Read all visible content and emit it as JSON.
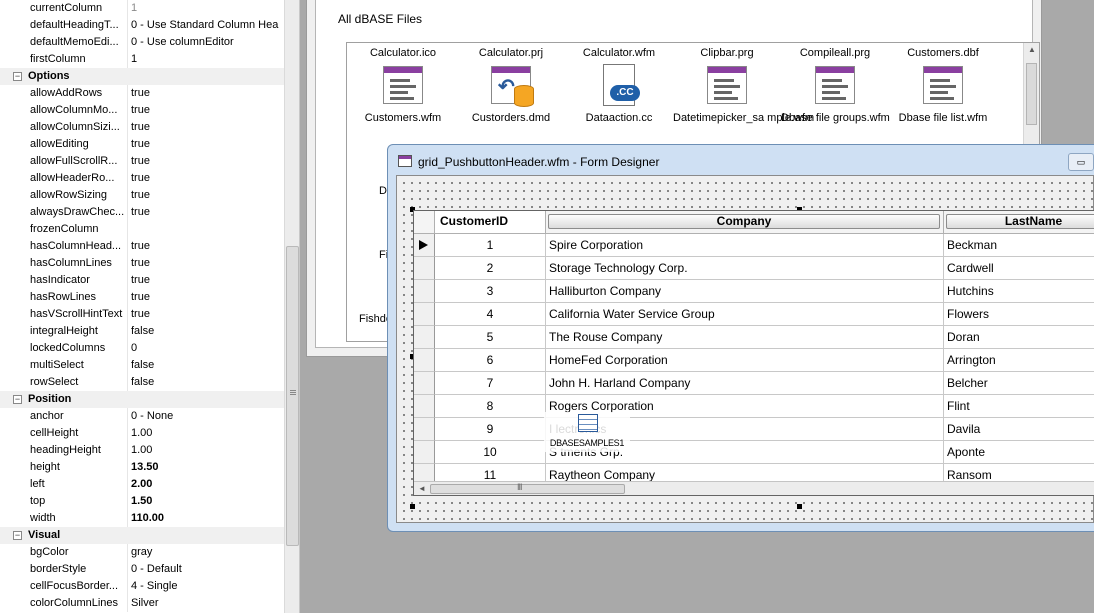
{
  "inspector": {
    "top_rows": [
      {
        "name": "currentColumn",
        "value": "1",
        "style": "muted"
      },
      {
        "name": "defaultHeadingT...",
        "value": "0 - Use Standard Column Hea",
        "style": ""
      },
      {
        "name": "defaultMemoEdi...",
        "value": "0 - Use columnEditor",
        "style": ""
      },
      {
        "name": "firstColumn",
        "value": "1",
        "style": ""
      }
    ],
    "options_label": "Options",
    "options_rows": [
      {
        "name": "allowAddRows",
        "value": "true",
        "style": ""
      },
      {
        "name": "allowColumnMo...",
        "value": "true",
        "style": ""
      },
      {
        "name": "allowColumnSizi...",
        "value": "true",
        "style": ""
      },
      {
        "name": "allowEditing",
        "value": "true",
        "style": ""
      },
      {
        "name": "allowFullScrollR...",
        "value": "true",
        "style": ""
      },
      {
        "name": "allowHeaderRo...",
        "value": "true",
        "style": ""
      },
      {
        "name": "allowRowSizing",
        "value": "true",
        "style": ""
      },
      {
        "name": "alwaysDrawChec...",
        "value": "true",
        "style": ""
      },
      {
        "name": "frozenColumn",
        "value": "",
        "style": ""
      },
      {
        "name": "hasColumnHead...",
        "value": "true",
        "style": ""
      },
      {
        "name": "hasColumnLines",
        "value": "true",
        "style": ""
      },
      {
        "name": "hasIndicator",
        "value": "true",
        "style": ""
      },
      {
        "name": "hasRowLines",
        "value": "true",
        "style": ""
      },
      {
        "name": "hasVScrollHintText",
        "value": "true",
        "style": ""
      },
      {
        "name": "integralHeight",
        "value": "false",
        "style": ""
      },
      {
        "name": "lockedColumns",
        "value": "0",
        "style": ""
      },
      {
        "name": "multiSelect",
        "value": "false",
        "style": ""
      },
      {
        "name": "rowSelect",
        "value": "false",
        "style": ""
      }
    ],
    "position_label": "Position",
    "position_rows": [
      {
        "name": "anchor",
        "value": "0 - None",
        "style": ""
      },
      {
        "name": "cellHeight",
        "value": "1.00",
        "style": ""
      },
      {
        "name": "headingHeight",
        "value": "1.00",
        "style": ""
      },
      {
        "name": "height",
        "value": "13.50",
        "style": "bold"
      },
      {
        "name": "left",
        "value": "2.00",
        "style": "bold"
      },
      {
        "name": "top",
        "value": "1.50",
        "style": "bold"
      },
      {
        "name": "width",
        "value": "110.00",
        "style": "bold"
      }
    ],
    "visual_label": "Visual",
    "visual_rows": [
      {
        "name": "bgColor",
        "value": "gray",
        "style": ""
      },
      {
        "name": "borderStyle",
        "value": "0 - Default",
        "style": ""
      },
      {
        "name": "cellFocusBorder...",
        "value": "4 - Single",
        "style": ""
      },
      {
        "name": "colorColumnLines",
        "value": "Silver",
        "style": ""
      }
    ]
  },
  "navigator": {
    "caption": "All dBASE Files",
    "files": [
      {
        "top": "Calculator.ico",
        "bottom": "Customers.wfm",
        "icon": "form-icon"
      },
      {
        "top": "Calculator.prj",
        "bottom": "Custorders.dmd",
        "icon": "datamodule-icon"
      },
      {
        "top": "Calculator.wfm",
        "bottom": "Dataaction.cc",
        "icon": "cc-file-icon"
      },
      {
        "top": "Clipbar.prg",
        "bottom": "Datetimepicker_sa mple.wfm",
        "icon": "form-icon"
      },
      {
        "top": "Compileall.prg",
        "bottom": "Dbase file groups.wfm",
        "icon": "form-icon"
      },
      {
        "top": "Customers.dbf",
        "bottom": "Dbase file list.wfm",
        "icon": "form-icon"
      }
    ],
    "partial_labels": [
      "Dl",
      "Fis",
      "Fishdele"
    ]
  },
  "designer": {
    "title": "grid_PushbuttonHeader.wfm - Form Designer",
    "columns": {
      "id": "CustomerID",
      "company": "Company",
      "lastname": "LastName"
    },
    "rows": [
      {
        "id": "1",
        "company": "Spire Corporation",
        "lastname": "Beckman"
      },
      {
        "id": "2",
        "company": "Storage Technology Corp.",
        "lastname": "Cardwell"
      },
      {
        "id": "3",
        "company": "Halliburton Company",
        "lastname": "Hutchins"
      },
      {
        "id": "4",
        "company": "California Water Service Group",
        "lastname": "Flowers"
      },
      {
        "id": "5",
        "company": "The Rouse Company",
        "lastname": "Doran"
      },
      {
        "id": "6",
        "company": "HomeFed Corporation",
        "lastname": "Arrington"
      },
      {
        "id": "7",
        "company": "John H. Harland Company",
        "lastname": "Belcher"
      },
      {
        "id": "8",
        "company": "Rogers Corporation",
        "lastname": "Flint"
      },
      {
        "id": "9",
        "company": "I                    lectronics",
        "lastname": "Davila"
      },
      {
        "id": "10",
        "company": "S          tments Grp.",
        "lastname": "Aponte"
      },
      {
        "id": "11",
        "company": "Raytheon Company",
        "lastname": "Ransom"
      }
    ],
    "scroll_grip": "III"
  },
  "db_overlay_label": "DBASESAMPLES1"
}
